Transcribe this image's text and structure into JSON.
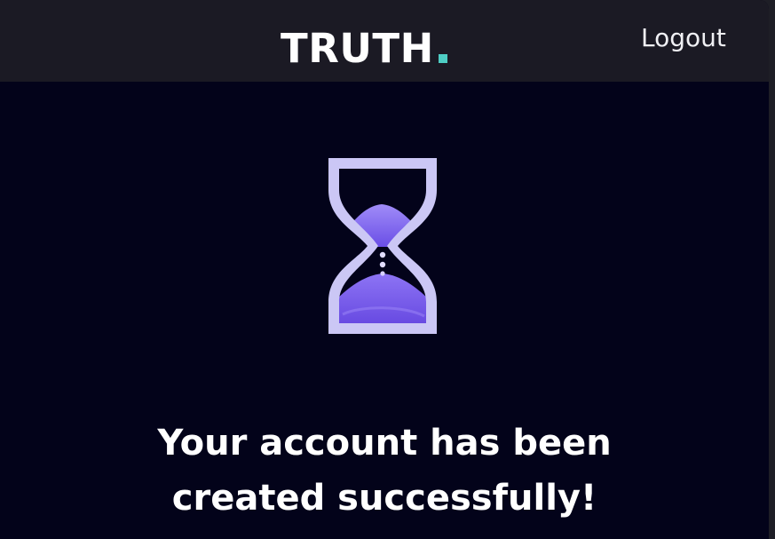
{
  "header": {
    "logo_text": "TRUTH",
    "logout_label": "Logout"
  },
  "status": {
    "icon": "hourglass-icon",
    "message_line1": "Your account has been",
    "message_line2": "created successfully!"
  },
  "colors": {
    "background": "#03031a",
    "header_background": "#1b1a24",
    "logo_accent": "#4ecdc4",
    "icon_frame": "#cbc7f5",
    "icon_sand": "#7b5ff0"
  }
}
